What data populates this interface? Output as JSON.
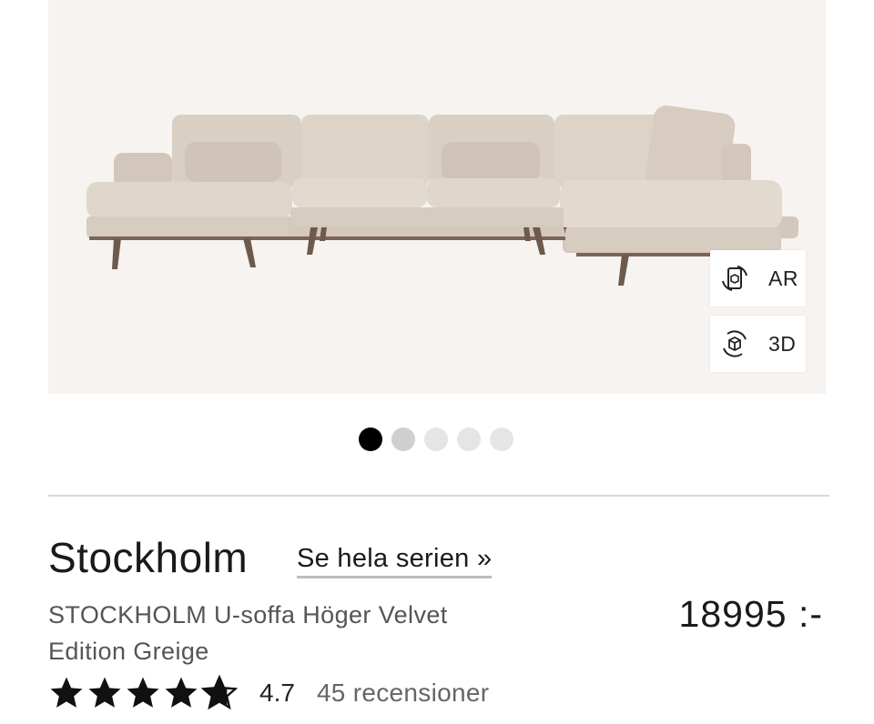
{
  "product": {
    "image_alt": "Stockholm U-soffa",
    "view_buttons": [
      {
        "label": "AR",
        "icon": "ar-phone-cube-icon"
      },
      {
        "label": "3D",
        "icon": "rotate-3d-cube-icon"
      }
    ],
    "carousel": {
      "count": 5,
      "active_index": 0
    },
    "title": "Stockholm",
    "series_link": "Se hela serien »",
    "subtitle": "STOCKHOLM U-soffa Höger Velvet Edition Greige",
    "price": "18995 :-",
    "rating": {
      "value": 4.7,
      "value_text": "4.7",
      "max": 5,
      "reviews_text": "45 recensioner"
    }
  },
  "colors": {
    "hero_bg": "#f6f3f1",
    "sofa_fabric": "#d9cfc3",
    "sofa_legs": "#6e5a4c",
    "active_dot": "#000000",
    "inactive_dot": "#e5e5e5"
  }
}
